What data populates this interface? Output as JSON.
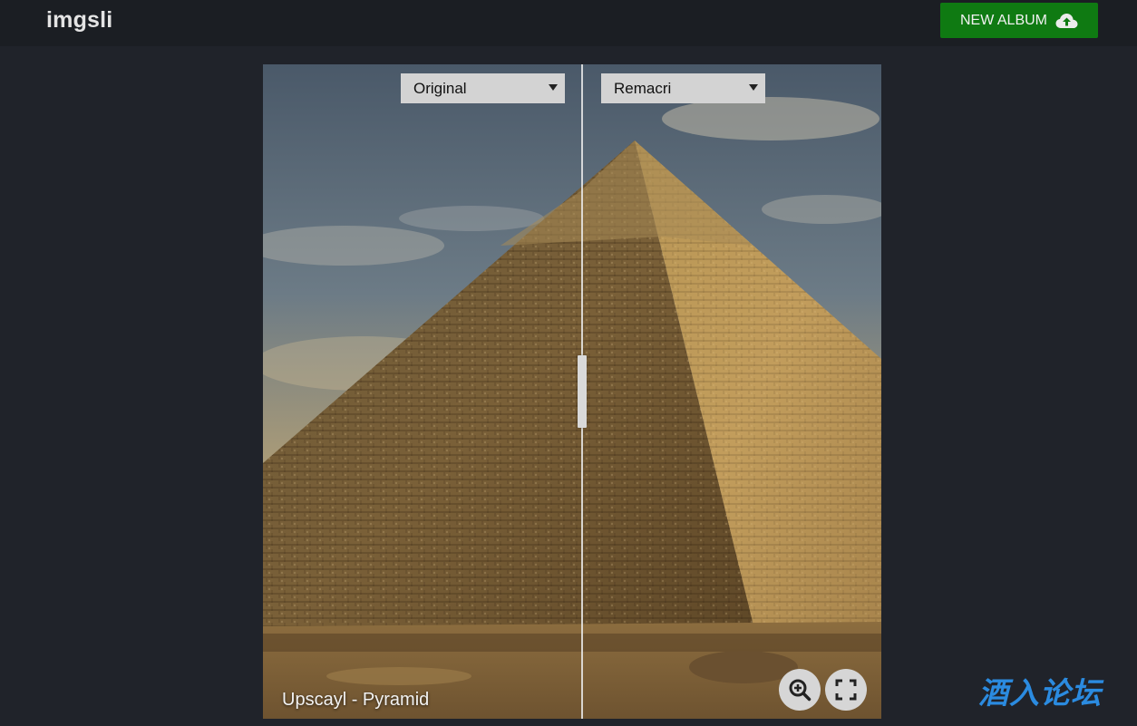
{
  "header": {
    "brand": "imgsli",
    "new_album_label": "NEW ALBUM",
    "new_album_icon": "cloud-upload-icon"
  },
  "viewer": {
    "left_select": {
      "selected": "Original"
    },
    "right_select": {
      "selected": "Remacri"
    },
    "caption": "Upscayl - Pyramid",
    "zoom_icon": "zoom-in-icon",
    "fullscreen_icon": "fullscreen-icon"
  },
  "watermark": "酒入论坛",
  "colors": {
    "page_bg": "#20232a",
    "topbar_bg": "#1b1e23",
    "accent_green": "#0f7a12",
    "watermark_blue": "#2b8be0"
  }
}
